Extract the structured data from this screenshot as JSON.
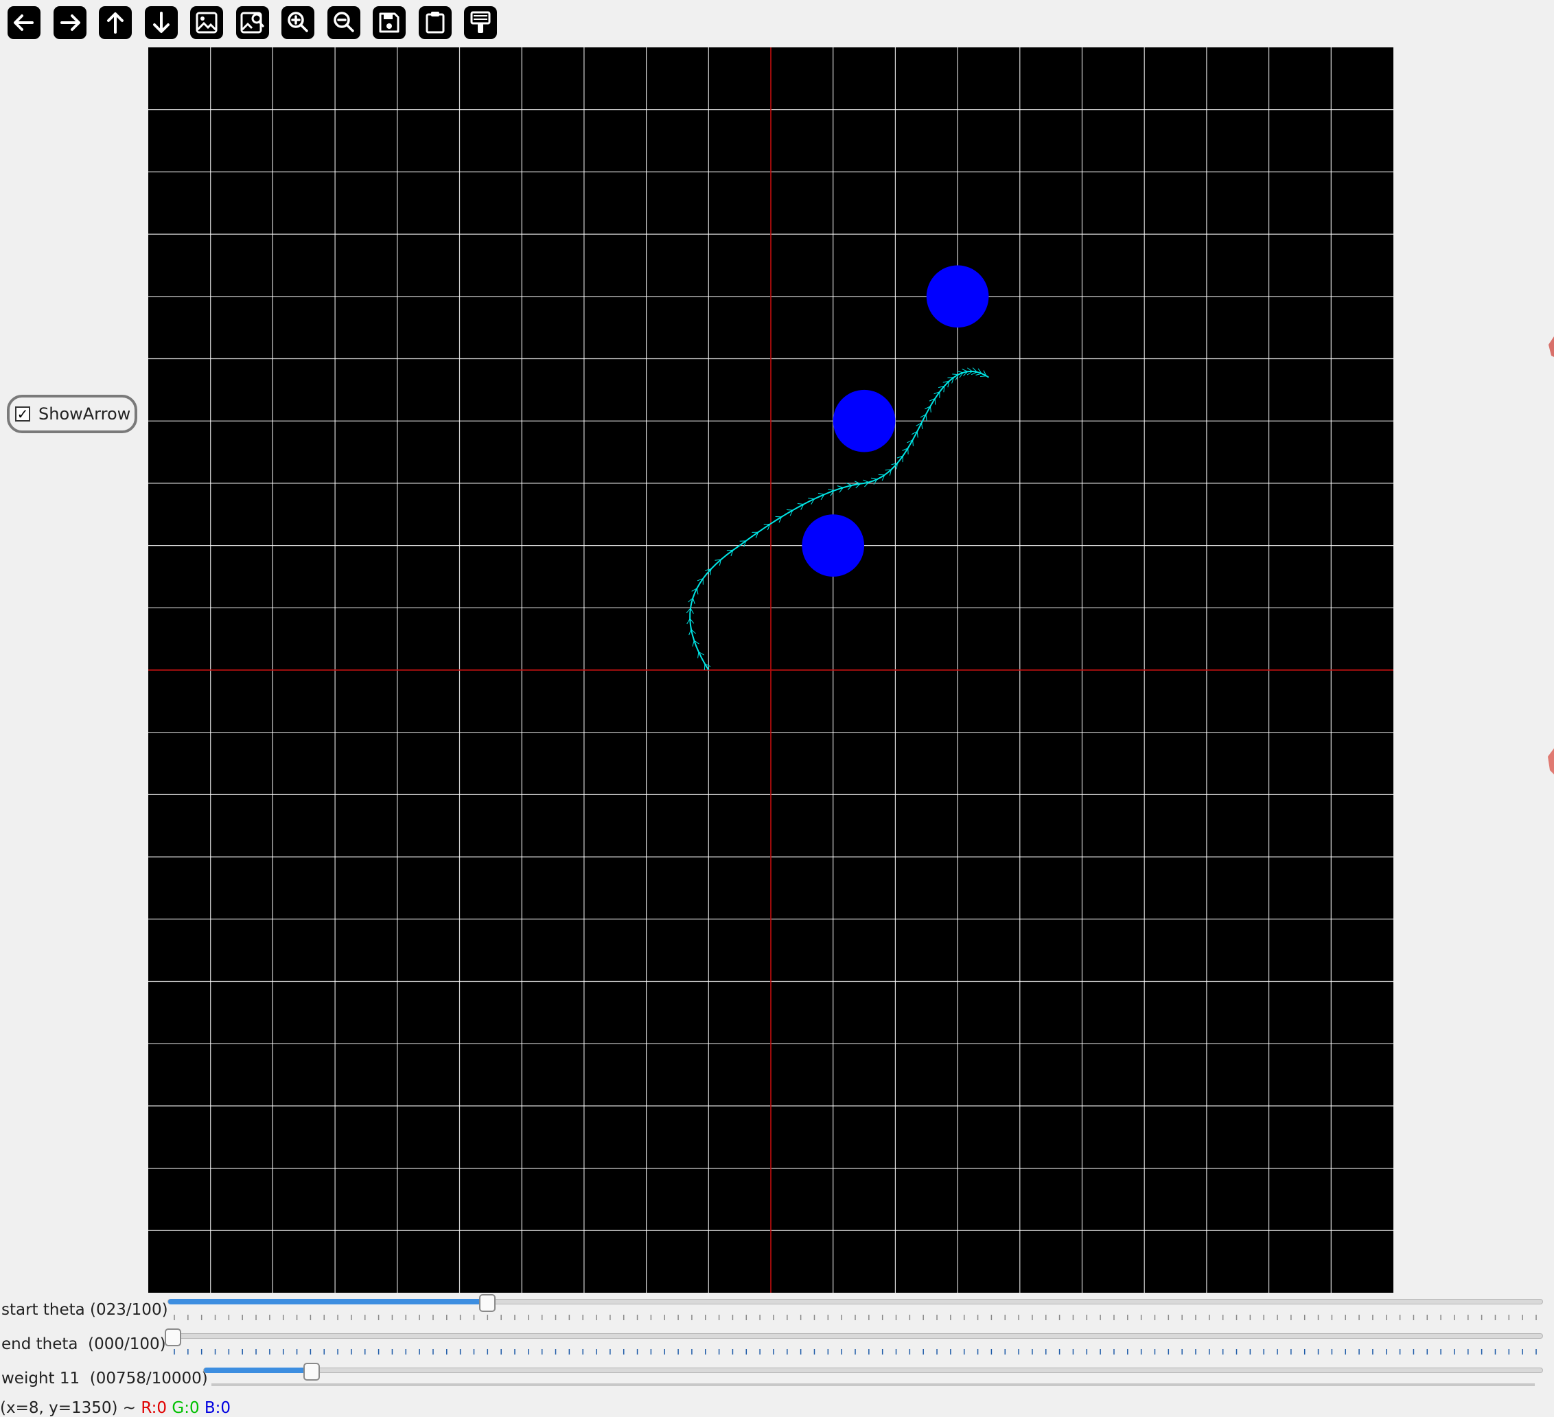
{
  "toolbar": {
    "buttons": [
      {
        "name": "pan-left-button",
        "icon": "arrow-left-icon"
      },
      {
        "name": "pan-right-button",
        "icon": "arrow-right-icon"
      },
      {
        "name": "pan-up-button",
        "icon": "arrow-up-icon"
      },
      {
        "name": "pan-down-button",
        "icon": "arrow-down-icon"
      },
      {
        "name": "fit-image-button",
        "icon": "image-icon"
      },
      {
        "name": "zoom-to-image-button",
        "icon": "image-zoom-icon"
      },
      {
        "name": "zoom-in-button",
        "icon": "zoom-in-icon"
      },
      {
        "name": "zoom-out-button",
        "icon": "zoom-out-icon"
      },
      {
        "name": "save-button",
        "icon": "save-icon"
      },
      {
        "name": "copy-to-clipboard-button",
        "icon": "clipboard-icon"
      },
      {
        "name": "properties-button",
        "icon": "paint-brush-icon"
      }
    ]
  },
  "canvas": {
    "background": "#000000",
    "grid_color": "#ffffff",
    "axis_color": "#c00000",
    "grid_divisions": 20,
    "obstacle_color": "#0000ff",
    "path_color": "#00e5e5"
  },
  "show_arrow": {
    "label": "ShowArrow",
    "checked": true,
    "check_glyph": "✓"
  },
  "sliders": [
    {
      "label": "start theta (023/100)",
      "value": 23,
      "max": 100
    },
    {
      "label": "end theta  (000/100)",
      "value": 0,
      "max": 100
    },
    {
      "label": "weight 11  (00758/10000)",
      "value": 758,
      "max": 10000
    }
  ],
  "status": {
    "coords": "(x=8, y=1350) ~ ",
    "r": "R:0",
    "g": "G:0",
    "b": "B:0"
  }
}
